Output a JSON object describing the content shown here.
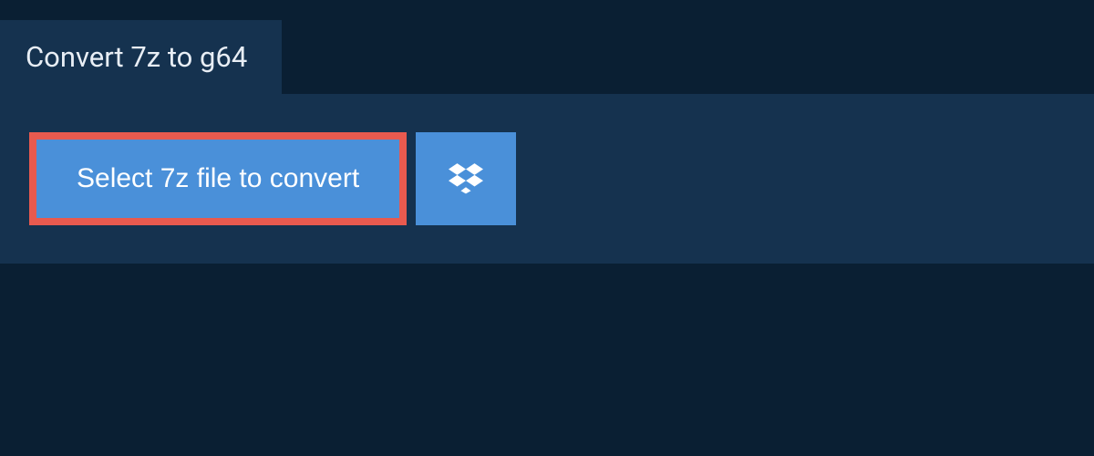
{
  "tab": {
    "title": "Convert 7z to g64"
  },
  "actions": {
    "select_file_label": "Select 7z file to convert",
    "dropbox_icon": "dropbox-icon"
  },
  "colors": {
    "background": "#0a1f33",
    "panel": "#15324f",
    "button": "#4a90d9",
    "highlight_border": "#e85a4f",
    "text": "#ffffff"
  }
}
